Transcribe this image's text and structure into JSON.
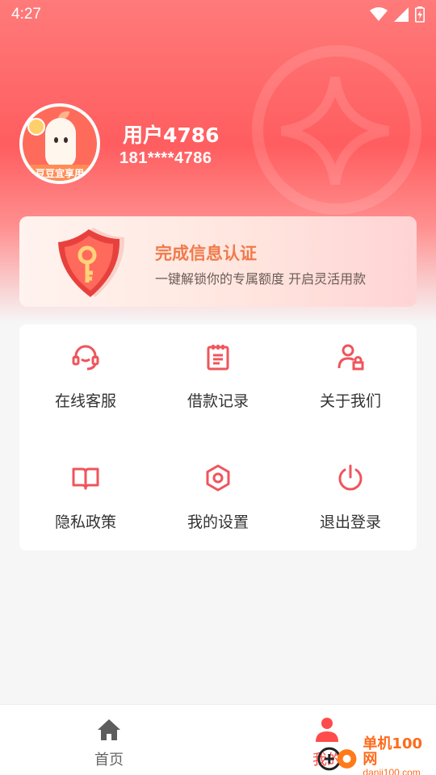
{
  "status_bar": {
    "time": "4:27"
  },
  "profile": {
    "name": "用户4786",
    "phone": "181****4786",
    "avatar_ribbon": "豆豆宜享用"
  },
  "verify_card": {
    "title": "完成信息认证",
    "subtitle": "一键解锁你的专属额度 开启灵活用款"
  },
  "menu": {
    "items": [
      {
        "label": "在线客服",
        "icon": "headset-icon"
      },
      {
        "label": "借款记录",
        "icon": "clipboard-icon"
      },
      {
        "label": "关于我们",
        "icon": "user-lock-icon"
      },
      {
        "label": "隐私政策",
        "icon": "book-icon"
      },
      {
        "label": "我的设置",
        "icon": "settings-hexagon-icon"
      },
      {
        "label": "退出登录",
        "icon": "power-icon"
      }
    ]
  },
  "bottom_nav": {
    "home_label": "首页",
    "mine_label": "我的"
  },
  "watermark": {
    "main": "单机100网",
    "sub": "danji100.com"
  },
  "colors": {
    "accent": "#ff4b4b",
    "icon": "#f0545c",
    "verify_title": "#f07a4a",
    "hero_top": "#ff7a7a"
  }
}
